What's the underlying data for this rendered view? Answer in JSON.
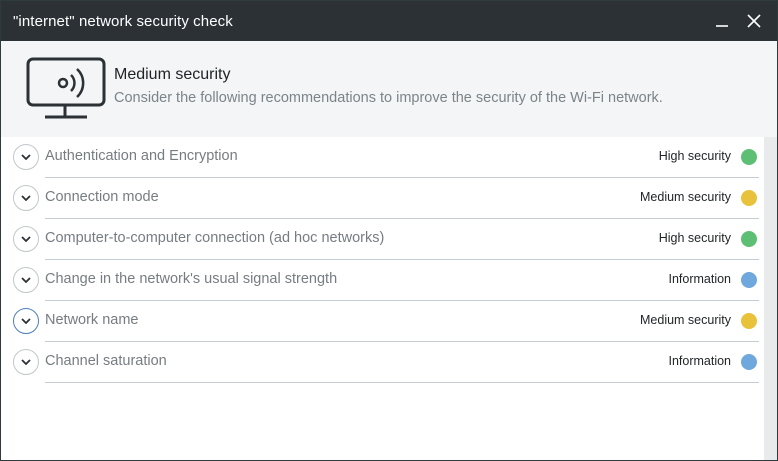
{
  "window": {
    "title": "\"internet\" network security check"
  },
  "header": {
    "title": "Medium security",
    "description": "Consider the following recommendations to improve the security of the Wi-Fi network.",
    "icon": "monitor-wifi-icon"
  },
  "colors": {
    "high": "#5dbf74",
    "medium": "#e8c23a",
    "info": "#6fa8dc",
    "titlebar": "#2b3135"
  },
  "items": [
    {
      "label": "Authentication and Encryption",
      "status": "High security",
      "level": "high"
    },
    {
      "label": "Connection mode",
      "status": "Medium security",
      "level": "medium"
    },
    {
      "label": "Computer-to-computer connection (ad hoc networks)",
      "status": "High security",
      "level": "high"
    },
    {
      "label": "Change in the network's usual signal strength",
      "status": "Information",
      "level": "info"
    },
    {
      "label": "Network name",
      "status": "Medium security",
      "level": "medium"
    },
    {
      "label": "Channel saturation",
      "status": "Information",
      "level": "info"
    }
  ]
}
